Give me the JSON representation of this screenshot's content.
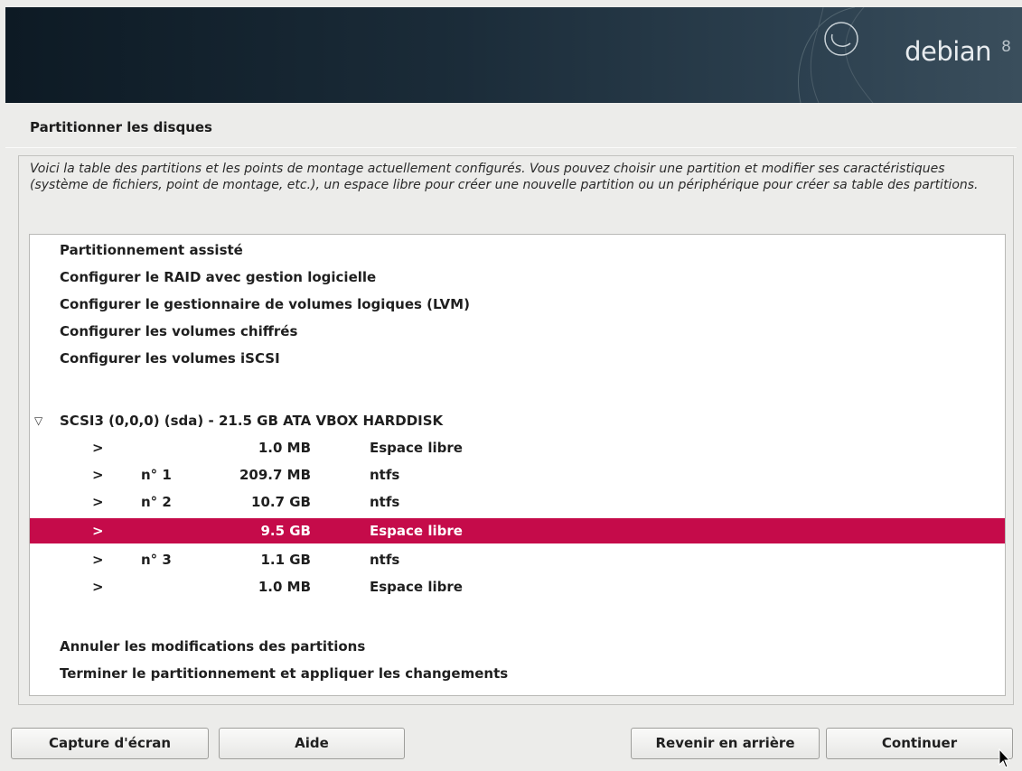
{
  "header": {
    "logo_text": "debian",
    "logo_version": "8"
  },
  "page": {
    "title": "Partitionner les disques",
    "intro": "Voici la table des partitions et les points de montage actuellement configurés. Vous pouvez choisir une partition et modifier ses caractéristiques (système de fichiers, point de montage, etc.), un espace libre pour créer une nouvelle partition ou un périphérique pour créer sa table des partitions."
  },
  "menu_top": [
    {
      "label": "Partitionnement assisté"
    },
    {
      "label": "Configurer le RAID avec gestion logicielle"
    },
    {
      "label": "Configurer le gestionnaire de volumes logiques (LVM)"
    },
    {
      "label": "Configurer les volumes chiffrés"
    },
    {
      "label": "Configurer les volumes iSCSI"
    }
  ],
  "disk": {
    "label": "SCSI3 (0,0,0) (sda) - 21.5 GB ATA VBOX HARDDISK",
    "expand_glyph": "▽",
    "partitions": [
      {
        "arrow": ">",
        "num": "",
        "size": "1.0 MB",
        "fs": "Espace libre",
        "selected": false
      },
      {
        "arrow": ">",
        "num": "n° 1",
        "size": "209.7 MB",
        "fs": "ntfs",
        "selected": false
      },
      {
        "arrow": ">",
        "num": "n° 2",
        "size": "10.7 GB",
        "fs": "ntfs",
        "selected": false
      },
      {
        "arrow": ">",
        "num": "",
        "size": "9.5 GB",
        "fs": "Espace libre",
        "selected": true
      },
      {
        "arrow": ">",
        "num": "n° 3",
        "size": "1.1 GB",
        "fs": "ntfs",
        "selected": false
      },
      {
        "arrow": ">",
        "num": "",
        "size": "1.0 MB",
        "fs": "Espace libre",
        "selected": false
      }
    ]
  },
  "menu_bottom": [
    {
      "label": "Annuler les modifications des partitions"
    },
    {
      "label": "Terminer le partitionnement et appliquer les changements"
    }
  ],
  "buttons": {
    "screenshot": "Capture d'écran",
    "help": "Aide",
    "back": "Revenir en arrière",
    "continue": "Continuer"
  },
  "colors": {
    "selection": "#c50b4a",
    "banner": "#1b2c39"
  }
}
